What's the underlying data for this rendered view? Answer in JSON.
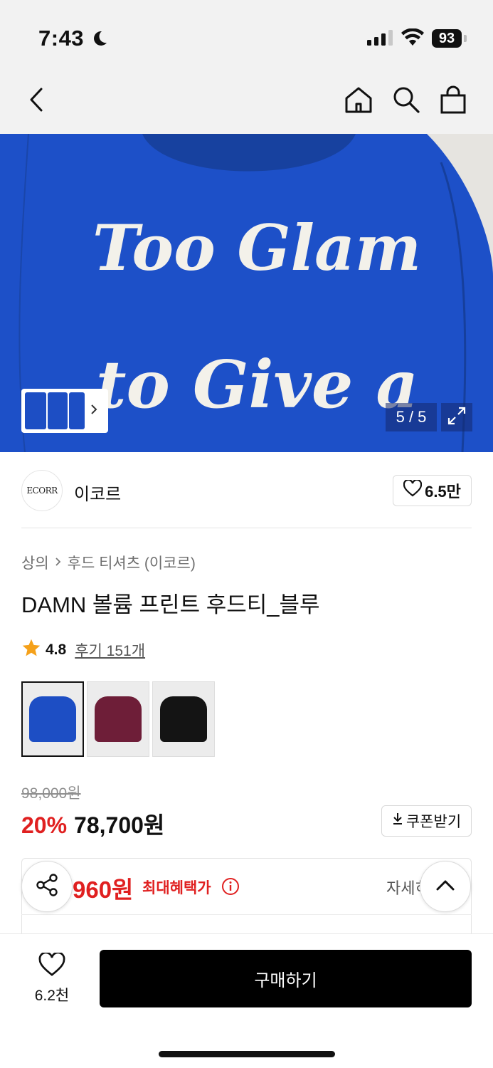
{
  "status_bar": {
    "time": "7:43",
    "battery": "93"
  },
  "nav": {
    "back_icon": "chevron-left-icon",
    "home_icon": "home-icon",
    "search_icon": "search-icon",
    "bag_icon": "shopping-bag-icon"
  },
  "gallery": {
    "image_text_line1": "Too Glam",
    "image_text_line2": "to Give a",
    "counter": "5 / 5",
    "product_color": "#1b4fc7"
  },
  "brand": {
    "logo_text": "ECORR",
    "name": "이코르",
    "likes": "6.5만"
  },
  "breadcrumb": {
    "category": "상의",
    "subcategory": "후드 티셔츠 (이코르)"
  },
  "product": {
    "title": "DAMN 볼륨 프린트 후드티_블루",
    "rating": "4.8",
    "reviews": "후기 151개",
    "variants": [
      {
        "color": "#1d4ec4",
        "selected": true
      },
      {
        "color": "#6e1e38",
        "selected": false
      },
      {
        "color": "#141414",
        "selected": false
      }
    ],
    "original_price": "98,000원",
    "discount": "20%",
    "price": "78,700원",
    "coupon_label": "쿠폰받기"
  },
  "benefit": {
    "price": "960원",
    "label": "최대혜택가",
    "detail": "자세히"
  },
  "bottom_bar": {
    "wish_count": "6.2천",
    "buy_label": "구매하기"
  },
  "colors": {
    "accent_red": "#e02020",
    "buy_button": "#000000"
  }
}
